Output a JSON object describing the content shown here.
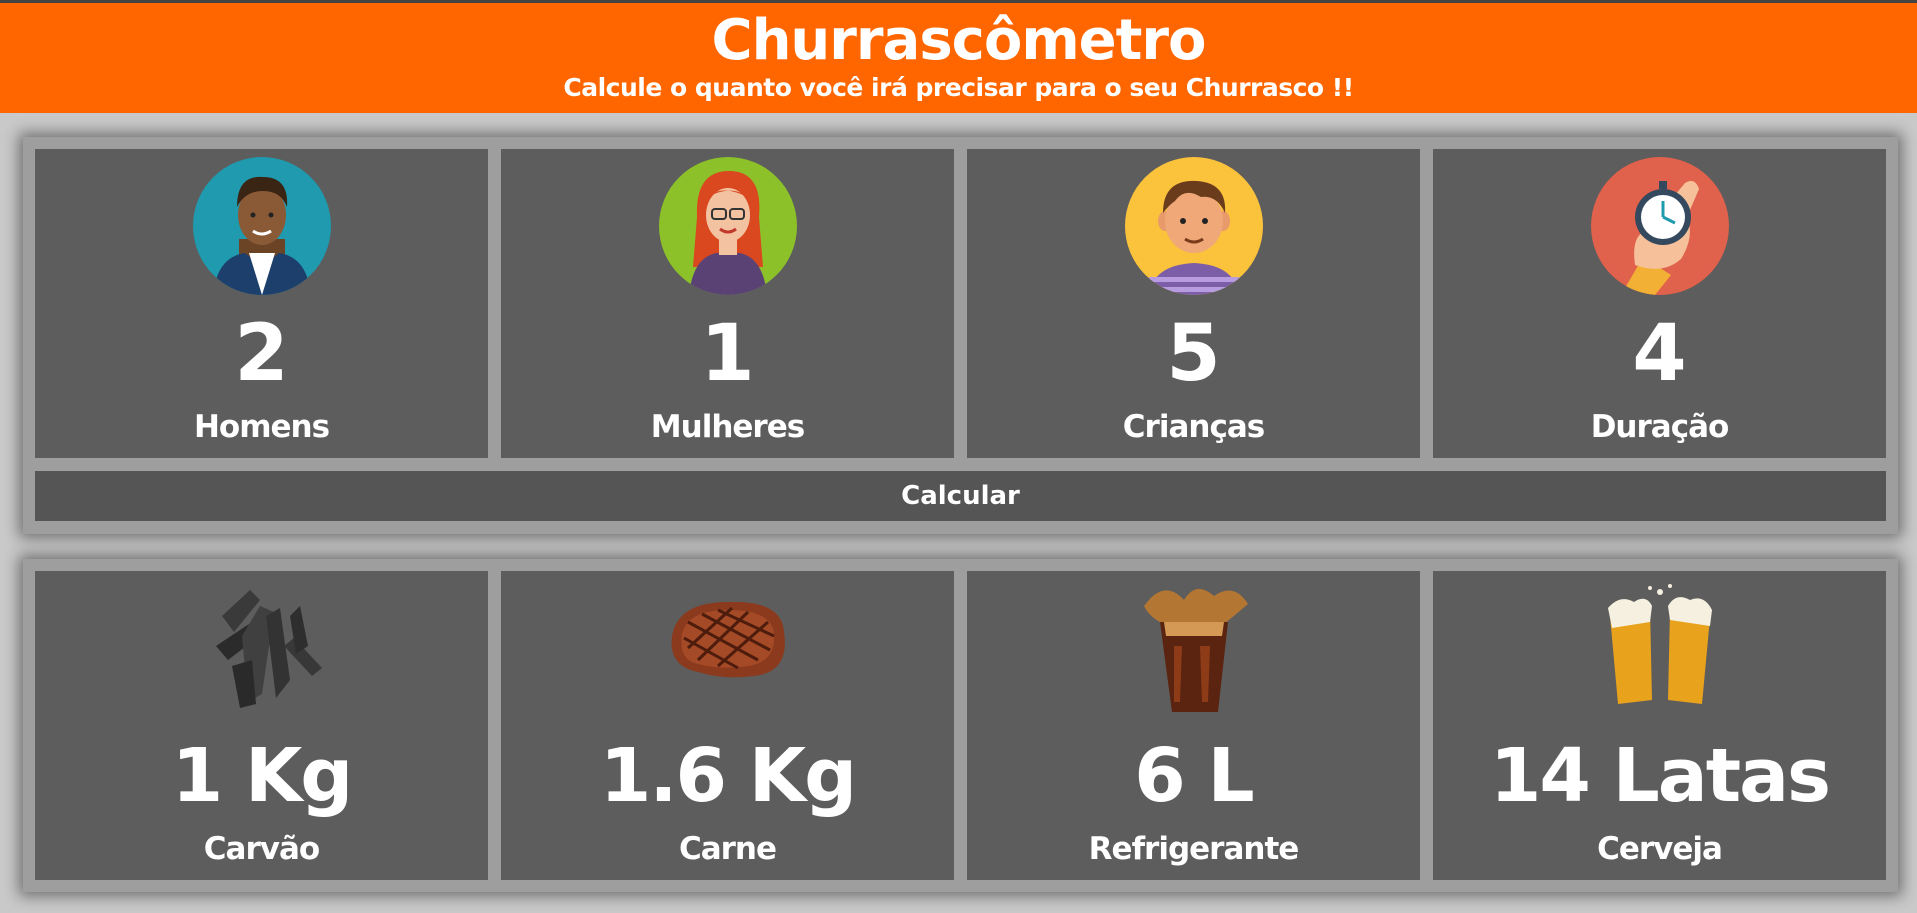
{
  "header": {
    "title": "Churrascômetro",
    "subtitle": "Calcule o quanto você irá precisar para o seu Churrasco !!"
  },
  "inputs": [
    {
      "icon": "man-avatar-icon",
      "value": "2",
      "label": "Homens",
      "bg": "#1f9aae"
    },
    {
      "icon": "woman-avatar-icon",
      "value": "1",
      "label": "Mulheres",
      "bg": "#8dc12a"
    },
    {
      "icon": "child-avatar-icon",
      "value": "5",
      "label": "Crianças",
      "bg": "#fbc23c"
    },
    {
      "icon": "stopwatch-icon",
      "value": "4",
      "label": "Duração",
      "bg": "#e0614c"
    }
  ],
  "calculate_button": "Calcular",
  "results": [
    {
      "icon": "charcoal-icon",
      "value": "1 Kg",
      "label": "Carvão"
    },
    {
      "icon": "steak-icon",
      "value": "1.6 Kg",
      "label": "Carne"
    },
    {
      "icon": "soda-glass-icon",
      "value": "6 L",
      "label": "Refrigerante"
    },
    {
      "icon": "beer-glasses-icon",
      "value": "14 Latas",
      "label": "Cerveja"
    }
  ],
  "colors": {
    "accent": "#ff6600",
    "card": "#5d5d5d",
    "panel": "#9e9e9e",
    "page": "#c9c9c9",
    "button": "#555555"
  }
}
